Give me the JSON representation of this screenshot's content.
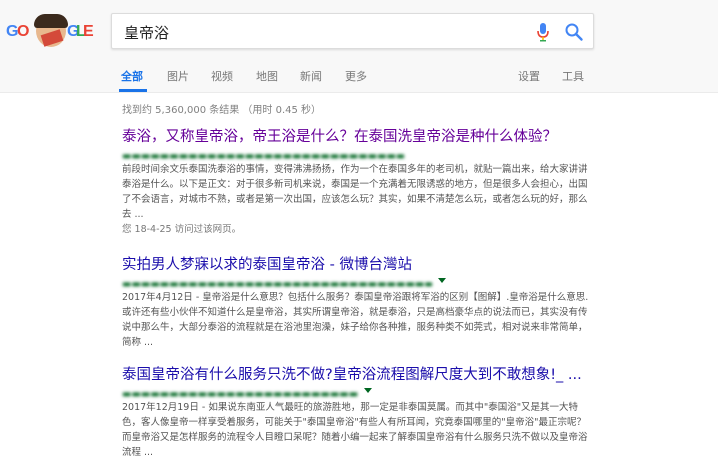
{
  "search": {
    "query": "皇帝浴"
  },
  "logo": {
    "letters": [
      "G",
      "O",
      "O",
      "G",
      "L",
      "E"
    ]
  },
  "colors": {
    "accent": "#1a73e8",
    "visited_link": "#660099",
    "link": "#1a0dab",
    "url_green": "#006621",
    "snippet_gray": "#545454"
  },
  "icons": {
    "voice": "mic-icon",
    "search": "search-icon"
  },
  "tabs": [
    {
      "label": "全部",
      "active": true
    },
    {
      "label": "图片"
    },
    {
      "label": "视频"
    },
    {
      "label": "地图"
    },
    {
      "label": "新闻"
    },
    {
      "label": "更多"
    }
  ],
  "tools": {
    "settings": "设置",
    "tools": "工具"
  },
  "stats": "找到约 5,360,000 条结果  （用时 0.45 秒）",
  "results": [
    {
      "title": "泰浴，又称皇帝浴，帝王浴是什么？在泰国洗皇帝浴是种什么体验？",
      "snippet": "前段时间余文乐泰国洗泰浴的事情，变得沸沸扬扬，作为一个在泰国多年的老司机，就贴一篇出来，给大家讲讲泰浴是什么。以下是正文：对于很多新司机来说，泰国是一个充满着无限诱惑的地方，但是很多人会担心，出国了不会语言，对城市不熟，或者是第一次出国，应该怎么玩？其实，如果不清楚怎么玩，或者怎么玩的好，那么去 ...",
      "visited": "您 18-4-25 访问过该网页。"
    },
    {
      "title": "实拍男人梦寐以求的泰国皇帝浴 - 微博台灣站",
      "snippet": "2017年4月12日 - 皇帝浴是什么意思？包括什么服务？泰国皇帝浴跟将军浴的区别【图解】.皇帝浴是什么意思.或许还有些小伙伴不知道什么是皇帝浴，其实所谓皇帝浴，就是泰浴，只是高档豪华点的说法而已，其实没有传说中那么牛，大部分泰浴的流程就是在浴池里泡澡，妹子给你各种推，服务种类不如莞式，相对说来非常简单，简称 ..."
    },
    {
      "title": "泰国皇帝浴有什么服务只洗不做?皇帝浴流程图解尺度大到不敢想象!_ ...",
      "snippet": "2017年12月19日 - 如果说东南亚人气最旺的旅游胜地，那一定是非泰国莫属。而其中\"泰国浴\"又是其一大特色，客人像皇帝一样享受着服务，可能关于\"泰国皇帝浴\"有些人有所耳闻，究竟泰国哪里的\"皇帝浴\"最正宗呢？而皇帝浴又是怎样服务的流程令人目瞪口呆呢？随着小编一起来了解泰国皇帝浴有什么服务只洗不做以及皇帝浴流程 ..."
    }
  ]
}
